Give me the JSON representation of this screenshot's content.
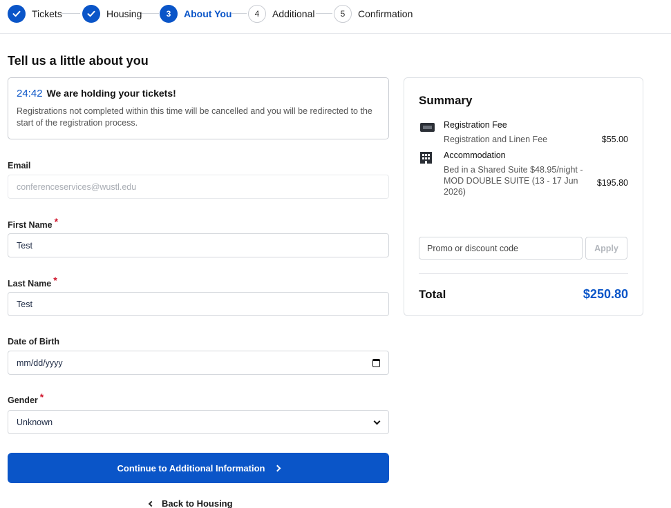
{
  "stepper": {
    "steps": [
      {
        "label": "Tickets",
        "state": "done"
      },
      {
        "label": "Housing",
        "state": "done"
      },
      {
        "label": "About You",
        "number": "3",
        "state": "current"
      },
      {
        "label": "Additional",
        "number": "4",
        "state": "todo"
      },
      {
        "label": "Confirmation",
        "number": "5",
        "state": "todo"
      }
    ]
  },
  "page_title": "Tell us a little about you",
  "timer": {
    "time": "24:42",
    "heading": "We are holding your tickets!",
    "message": "Registrations not completed within this time will be cancelled and you will be redirected to the start of the registration process."
  },
  "form": {
    "email": {
      "label": "Email",
      "value": "conferenceservices@wustl.edu"
    },
    "first_name": {
      "label": "First Name",
      "required_mark": "*",
      "value": "Test"
    },
    "last_name": {
      "label": "Last Name",
      "required_mark": "*",
      "value": "Test"
    },
    "dob": {
      "label": "Date of Birth",
      "placeholder": "mm/dd/yyyy"
    },
    "gender": {
      "label": "Gender",
      "required_mark": "*",
      "value": "Unknown"
    }
  },
  "actions": {
    "continue_label": "Continue to Additional Information",
    "back_label": "Back to Housing"
  },
  "summary": {
    "title": "Summary",
    "items": [
      {
        "icon": "ticket-icon",
        "name": "Registration Fee",
        "description": "Registration and Linen Fee",
        "price": "$55.00"
      },
      {
        "icon": "building-icon",
        "name": "Accommodation",
        "description_lines": [
          "Bed in a Shared Suite $48.95/night -",
          "MOD DOUBLE SUITE (13 - 17 Jun",
          "2026)"
        ],
        "price": "$195.80"
      }
    ],
    "promo_placeholder": "Promo or discount code",
    "apply_label": "Apply",
    "total_label": "Total",
    "total_value": "$250.80"
  },
  "colors": {
    "accent": "#0a55c8",
    "required": "#d0162c"
  }
}
